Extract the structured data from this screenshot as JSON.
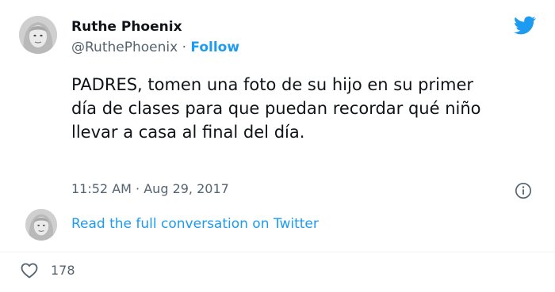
{
  "tweet": {
    "author_name": "Ruthe Phoenix",
    "handle": "@RuthePhoenix",
    "separator": "·",
    "follow_label": "Follow",
    "text": "PADRES, tomen una foto de su hijo en su primer día de clases para que puedan recordar qué niño llevar a casa al final del día.",
    "time": "11:52 AM",
    "date": "Aug 29, 2017",
    "read_full": "Read the full conversation on Twitter",
    "like_count": "178"
  },
  "icons": {
    "brand": "twitter-bird-icon",
    "info": "info-icon",
    "like": "heart-icon"
  },
  "colors": {
    "accent": "#1d9bf0",
    "text_primary": "#0f1419",
    "text_secondary": "#536471",
    "divider": "#eff3f4"
  }
}
